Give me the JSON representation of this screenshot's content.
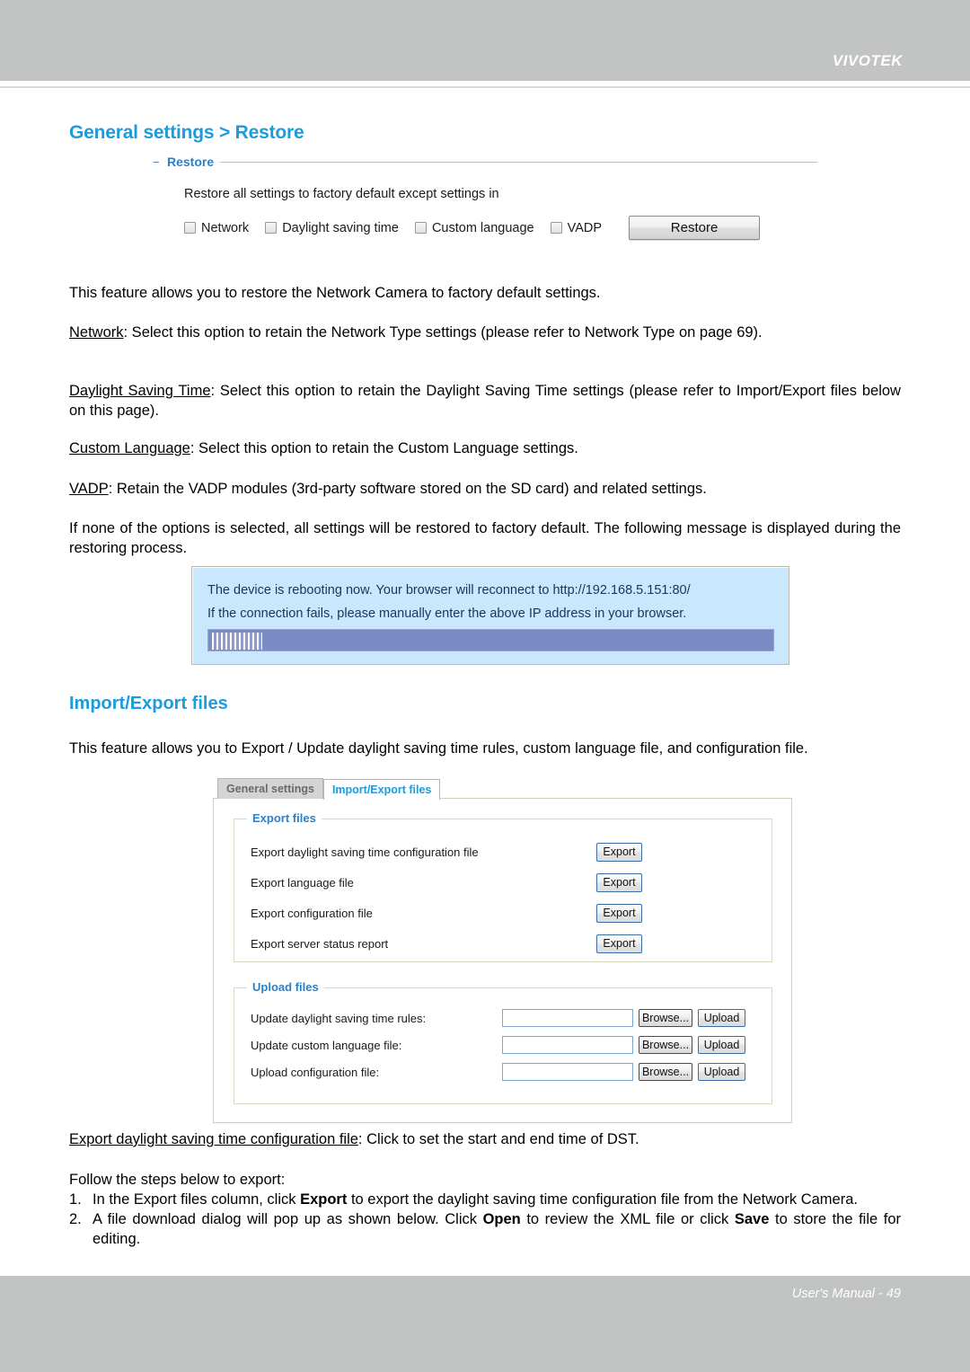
{
  "header": {
    "brand": "VIVOTEK"
  },
  "page": {
    "title": "General settings > Restore"
  },
  "restore_panel": {
    "legend": "Restore",
    "description": "Restore all settings to factory default except settings in",
    "checkboxes": [
      {
        "label": "Network",
        "checked": false
      },
      {
        "label": "Daylight saving time",
        "checked": false
      },
      {
        "label": "Custom language",
        "checked": false
      },
      {
        "label": "VADP",
        "checked": false
      }
    ],
    "restore_button": "Restore"
  },
  "body": {
    "intro": "This feature allows you to restore the Network Camera to factory default settings.",
    "network_term": "Network",
    "network_rest": ": Select this option to retain the Network Type settings (please refer to Network Type on page 69).",
    "dst_term": "Daylight Saving Time",
    "dst_rest": ": Select this option to retain the Daylight Saving Time settings (please refer to Import/Export files below on this page).",
    "lang_term": "Custom Language",
    "lang_rest": ": Select this option to retain the Custom Language settings.",
    "vadp_term": "VADP",
    "vadp_rest": ": Retain the VADP modules (3rd-party software stored on the SD card) and related settings.",
    "none_selected": "If none of the options is selected, all settings will be restored to factory default.  The following message is displayed during the restoring process."
  },
  "reboot_message": {
    "line1": "The device is rebooting now. Your browser will reconnect to http://192.168.5.151:80/",
    "line2": "If the connection fails, please manually enter the above IP address in your browser.",
    "progress_label": ""
  },
  "import_export": {
    "heading": "Import/Export files",
    "intro": "This feature allows you to Export / Update daylight saving time rules, custom language file, and configuration file.",
    "tabs": [
      {
        "label": "General settings",
        "active": false
      },
      {
        "label": "Import/Export files",
        "active": true
      }
    ],
    "export_files": {
      "legend": "Export files",
      "rows": [
        {
          "label": "Export daylight saving time configuration file",
          "button": "Export"
        },
        {
          "label": "Export language file",
          "button": "Export"
        },
        {
          "label": "Export configuration file",
          "button": "Export"
        },
        {
          "label": "Export server status report",
          "button": "Export"
        }
      ]
    },
    "upload_files": {
      "legend": "Upload files",
      "rows": [
        {
          "label": "Update daylight saving time rules:",
          "value": "",
          "browse": "Browse...",
          "upload": "Upload"
        },
        {
          "label": "Update custom language file:",
          "value": "",
          "browse": "Browse...",
          "upload": "Upload"
        },
        {
          "label": "Upload configuration file:",
          "value": "",
          "browse": "Browse...",
          "upload": "Upload"
        }
      ]
    }
  },
  "bottom_text": {
    "export_dst_term": "Export daylight saving time configuration file",
    "export_dst_rest": ": Click to set the start and end time of DST.",
    "follow_steps": "Follow the steps below to export:",
    "step1_a": "1.",
    "step1_b": "In the Export files column, click ",
    "step1_bold": "Export",
    "step1_c": " to export the daylight saving time configuration file from the Network Camera.",
    "step2_a": "2.",
    "step2_b": "A file download dialog will pop up as shown below. Click ",
    "step2_bold1": "Open",
    "step2_c": " to review the XML file or click ",
    "step2_bold2": "Save",
    "step2_d": " to store the file for editing."
  },
  "footer": {
    "text": "User's Manual - 49"
  },
  "colors": {
    "band": "#c2c4c4",
    "heading_blue": "#1d9bdc",
    "legend_blue": "#2f7fc1",
    "reboot_bg": "#cae8fd",
    "progress": "#7b8bc4"
  }
}
